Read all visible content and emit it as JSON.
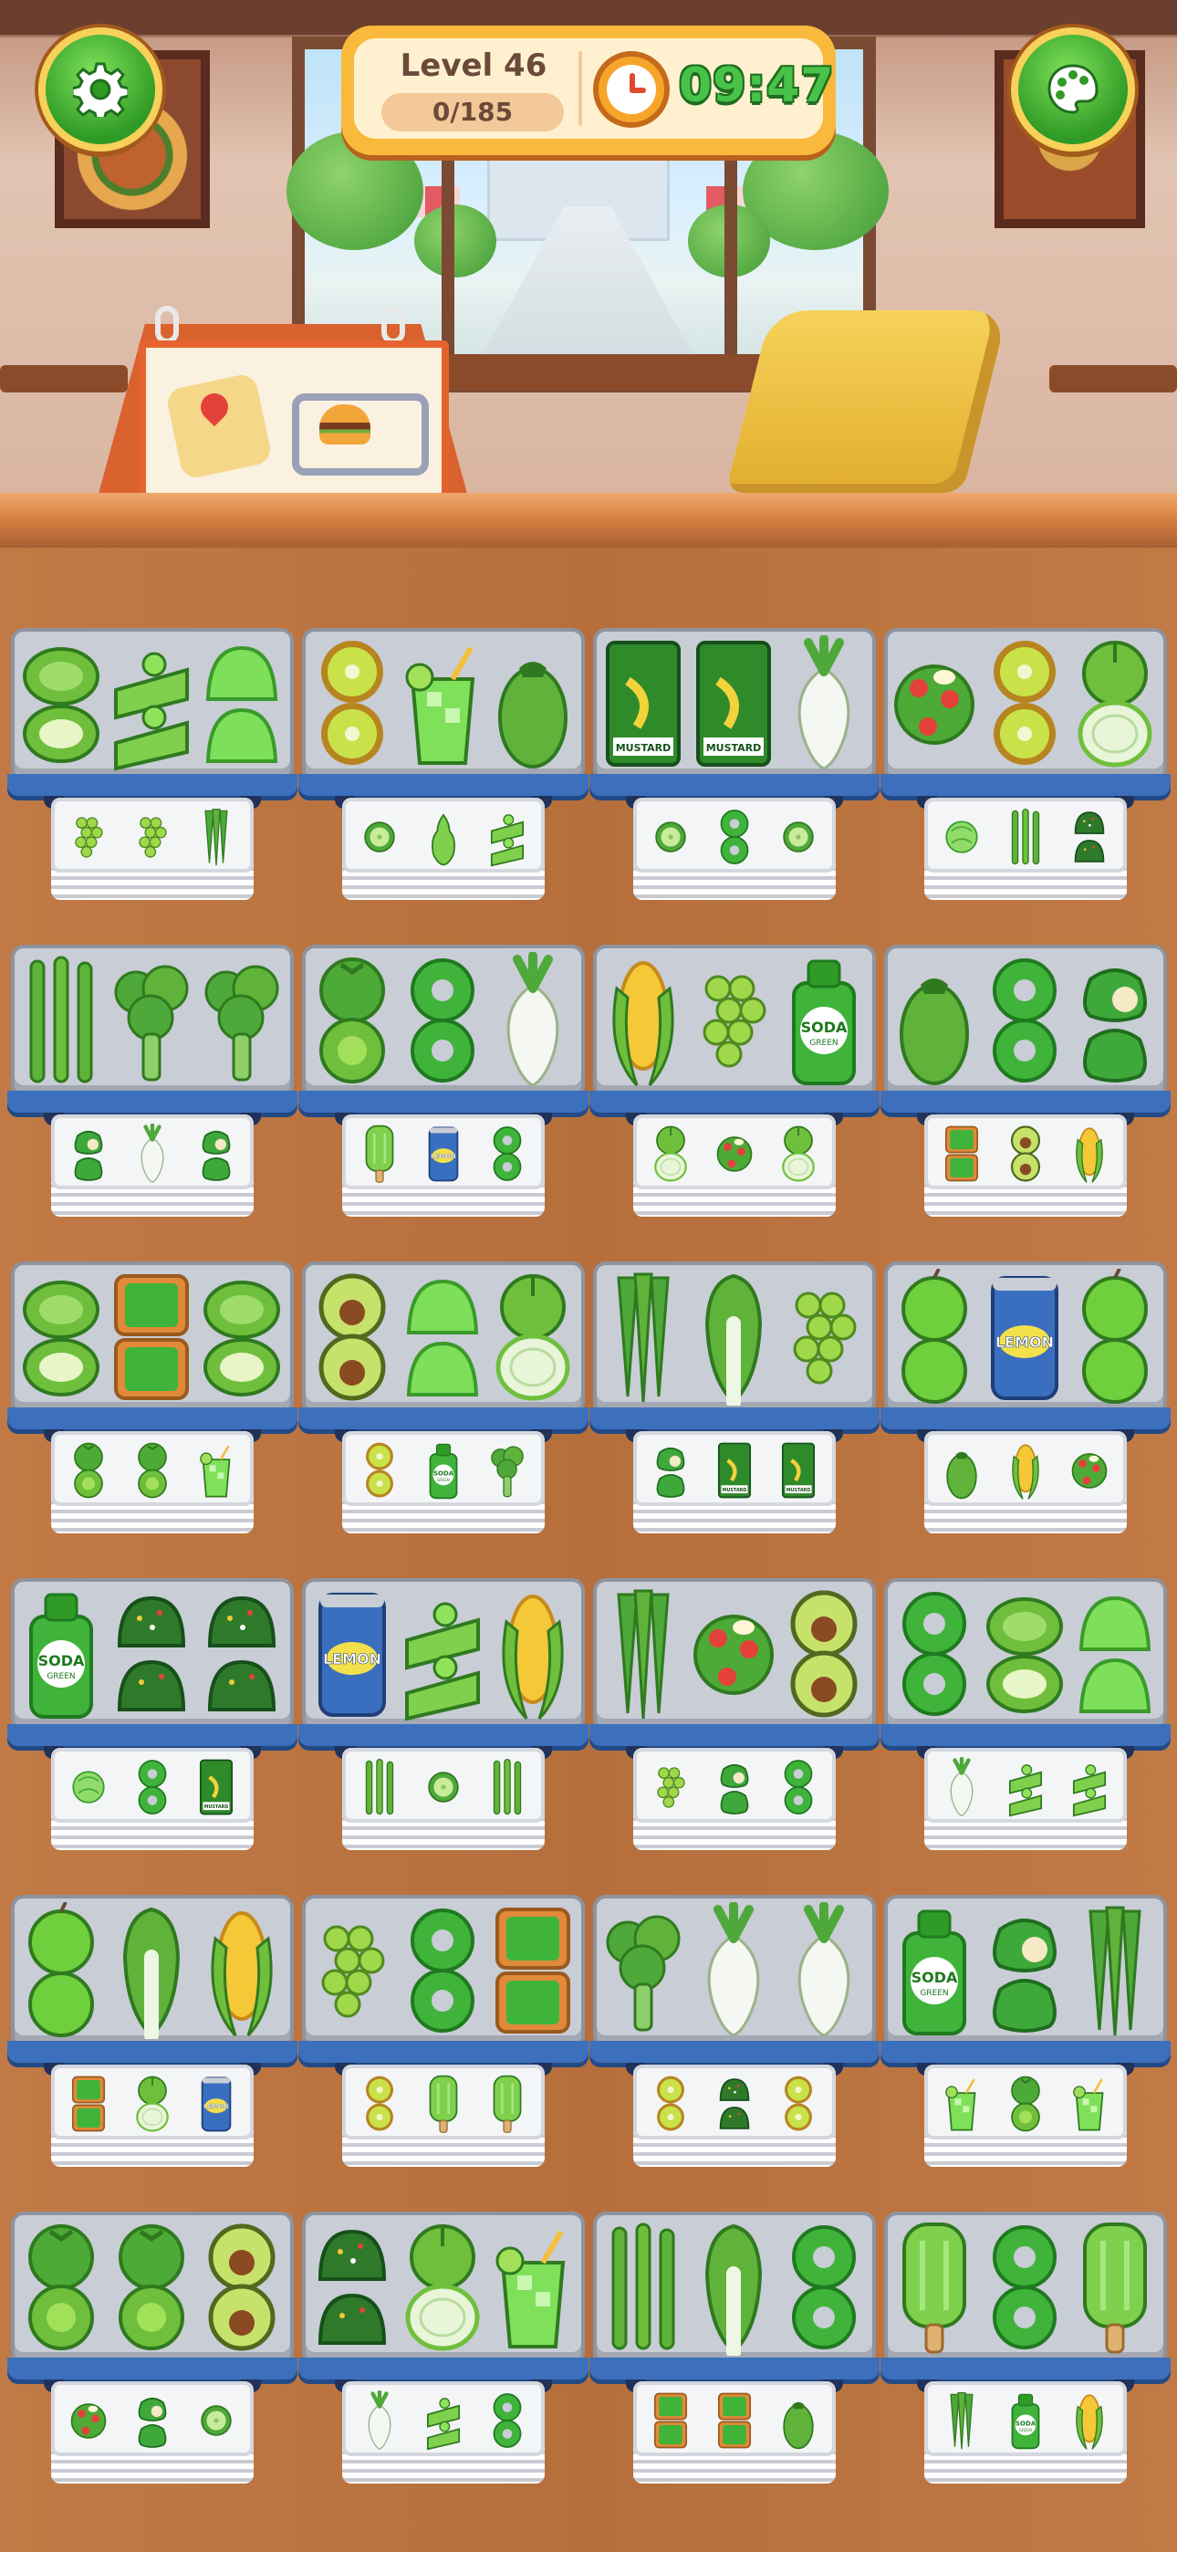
{
  "hud": {
    "level_label": "Level 46",
    "progress_text": "0/185",
    "progress_fraction": 0,
    "timer": "09:47"
  },
  "buttons": {
    "settings_icon": "gear-icon",
    "palette_icon": "palette-icon"
  },
  "calendar": {
    "icons": [
      "map-pin-icon",
      "delivery-truck-icon",
      "burger-icon"
    ]
  },
  "labels": {
    "mustard": "MUSTARD",
    "soda": "SODA",
    "soda_sub": "GREEN",
    "lemon": "LEMON"
  },
  "shelves": [
    {
      "front": [
        "melon-roll",
        "cake-slice",
        "jelly"
      ],
      "back": [
        "grapes",
        "grapes",
        "okra"
      ]
    },
    {
      "front": [
        "kiwi",
        "green-juice",
        "eggplant"
      ],
      "back": [
        "cucumber",
        "pear",
        "cake-slice"
      ]
    },
    {
      "front": [
        "mustard",
        "mustard",
        "radish"
      ],
      "back": [
        "cucumber",
        "donut",
        "cucumber"
      ]
    },
    {
      "front": [
        "salad",
        "kiwi",
        "onion"
      ],
      "back": [
        "lettuce",
        "asparagus",
        "matcha-cake"
      ]
    },
    {
      "front": [
        "asparagus",
        "broccoli",
        "broccoli"
      ],
      "back": [
        "pepper",
        "radish",
        "pepper"
      ]
    },
    {
      "front": [
        "tomato",
        "donut",
        "radish"
      ],
      "back": [
        "popsicle",
        "lemon-can",
        "donut"
      ]
    },
    {
      "front": [
        "corn",
        "grapes",
        "soda"
      ],
      "back": [
        "onion",
        "salad",
        "onion"
      ]
    },
    {
      "front": [
        "eggplant",
        "donut",
        "pepper"
      ],
      "back": [
        "matcha-box",
        "avocado",
        "corn"
      ]
    },
    {
      "front": [
        "melon-roll",
        "matcha-box",
        "melon-roll"
      ],
      "back": [
        "tomato",
        "tomato",
        "green-juice"
      ]
    },
    {
      "front": [
        "avocado",
        "jelly",
        "onion"
      ],
      "back": [
        "kiwi",
        "soda",
        "broccoli"
      ]
    },
    {
      "front": [
        "okra",
        "bok-choy",
        "grapes"
      ],
      "back": [
        "pepper",
        "mustard",
        "mustard"
      ]
    },
    {
      "front": [
        "apple",
        "lemon-can",
        "apple"
      ],
      "back": [
        "eggplant",
        "corn",
        "salad"
      ]
    },
    {
      "front": [
        "soda",
        "matcha-cake",
        "matcha-cake"
      ],
      "back": [
        "lettuce",
        "donut",
        "mustard"
      ]
    },
    {
      "front": [
        "lemon-can",
        "cake-slice",
        "corn"
      ],
      "back": [
        "asparagus",
        "cucumber",
        "asparagus"
      ]
    },
    {
      "front": [
        "okra",
        "salad",
        "avocado"
      ],
      "back": [
        "grapes",
        "pepper",
        "donut"
      ]
    },
    {
      "front": [
        "donut",
        "melon-roll",
        "jelly"
      ],
      "back": [
        "radish",
        "cake-slice",
        "cake-slice"
      ]
    },
    {
      "front": [
        "apple",
        "bok-choy",
        "corn"
      ],
      "back": [
        "matcha-box",
        "onion",
        "lemon-can"
      ]
    },
    {
      "front": [
        "grapes",
        "donut",
        "matcha-box"
      ],
      "back": [
        "kiwi",
        "popsicle",
        "popsicle"
      ]
    },
    {
      "front": [
        "broccoli",
        "radish",
        "radish"
      ],
      "back": [
        "kiwi",
        "matcha-cake",
        "kiwi"
      ]
    },
    {
      "front": [
        "soda",
        "pepper",
        "okra"
      ],
      "back": [
        "green-juice",
        "tomato",
        "green-juice"
      ]
    },
    {
      "front": [
        "tomato",
        "tomato",
        "avocado"
      ],
      "back": [
        "salad",
        "pepper",
        "cucumber"
      ]
    },
    {
      "front": [
        "matcha-cake",
        "onion",
        "green-juice"
      ],
      "back": [
        "radish",
        "cake-slice",
        "donut"
      ]
    },
    {
      "front": [
        "asparagus",
        "bok-choy",
        "donut"
      ],
      "back": [
        "matcha-box",
        "matcha-box",
        "eggplant"
      ]
    },
    {
      "front": [
        "popsicle",
        "donut",
        "popsicle"
      ],
      "back": [
        "okra",
        "soda",
        "corn"
      ]
    }
  ],
  "colors": {
    "wood": "#b8713d",
    "tray": "#c9cdd6",
    "tray_bar": "#3c6fbc",
    "hud_frame": "#f9b93c",
    "timer_green": "#49c24a",
    "button_green": "#3aa92c"
  }
}
